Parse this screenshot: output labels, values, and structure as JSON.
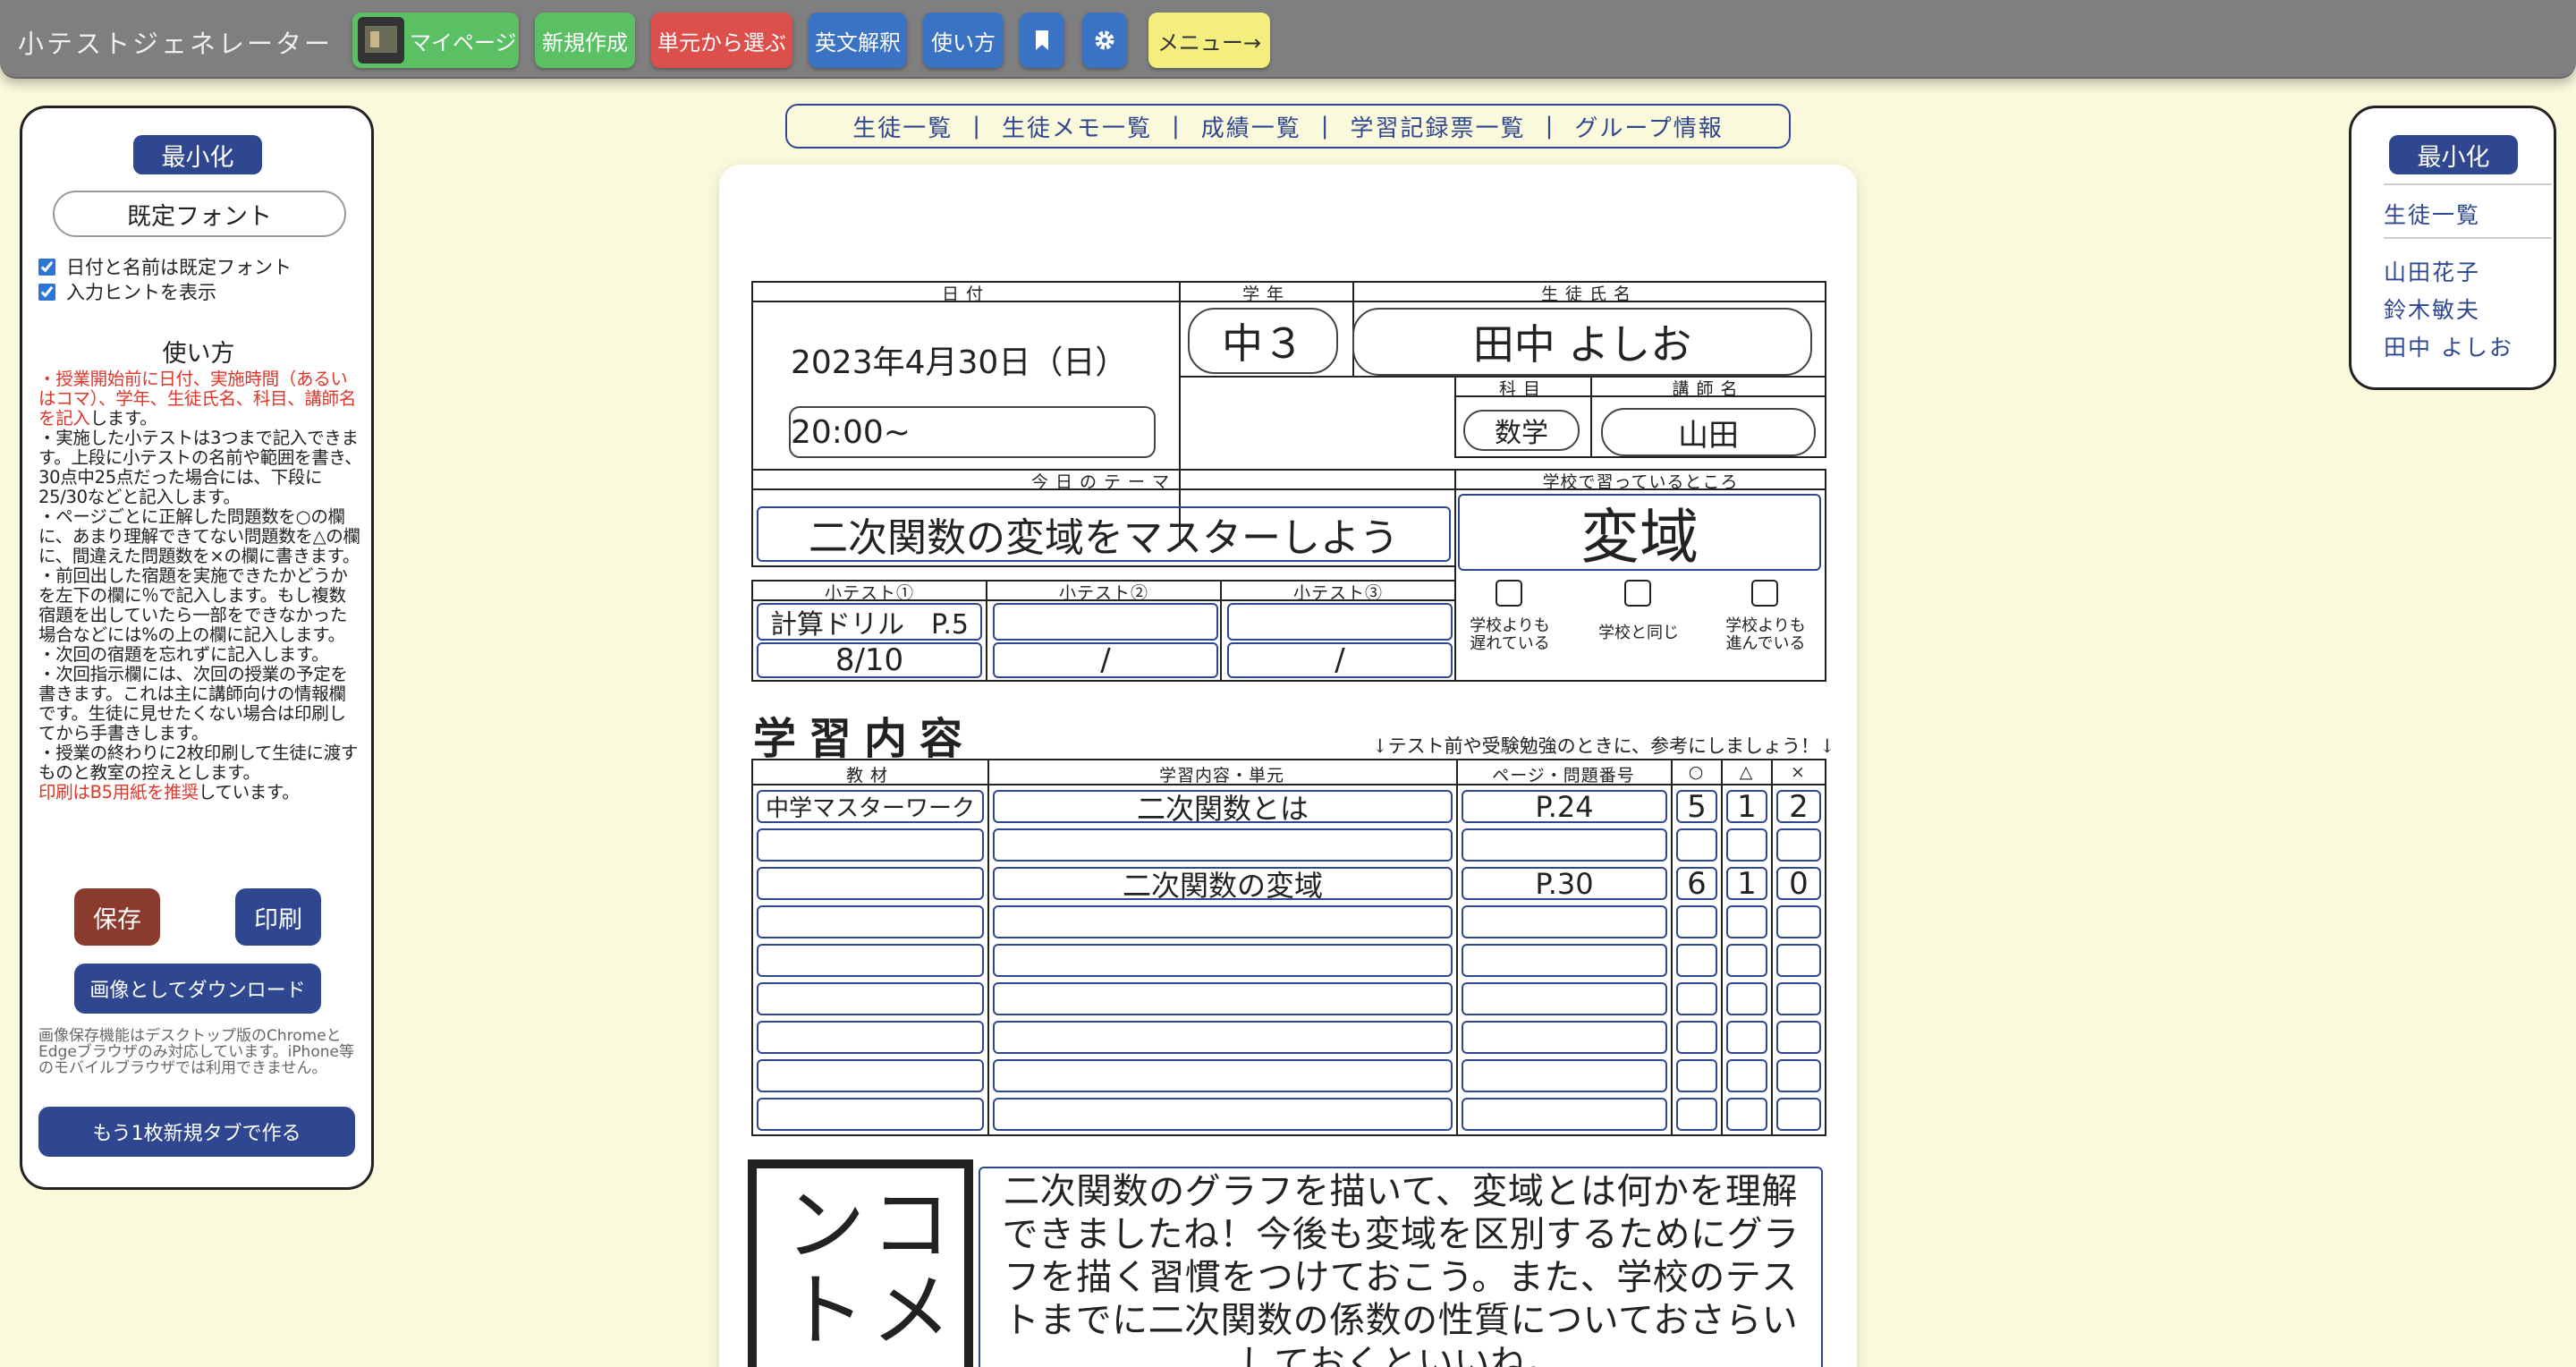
{
  "app_title": "小テストジェネレーター",
  "nav": {
    "mypage": "マイページ",
    "new": "新規作成",
    "unit": "単元から選ぶ",
    "english": "英文解釈",
    "howto": "使い方",
    "menu": "メニュー→",
    "colors": {
      "green": "#5bc063",
      "red": "#dc4f4a",
      "blue": "#3a72c4",
      "yellow": "#f4ee7e"
    }
  },
  "left": {
    "minimize": "最小化",
    "font_button": "既定フォント",
    "check1": "日付と名前は既定フォント",
    "check2": "入力ヒントを表示",
    "howto_title": "使い方",
    "p1_red": "・授業開始前に日付、実施時間（あるいはコマ）、学年、生徒氏名、科目、講師名を記入",
    "p1_rest": "します。",
    "p2": "・実施した小テストは3つまで記入できます。上段に小テストの名前や範囲を書き、30点中25点だった場合には、下段に25/30などと記入します。",
    "p3": "・ページごとに正解した問題数を○の欄に、あまり理解できてない問題数を△の欄に、間違えた問題数を×の欄に書きます。",
    "p4": "・前回出した宿題を実施できたかどうかを左下の欄に％で記入します。もし複数宿題を出していたら一部をできなかった場合などには%の上の欄に記入します。",
    "p5": "・次回の宿題を忘れずに記入します。",
    "p6": "・次回指示欄には、次回の授業の予定を書きます。これは主に講師向けの情報欄です。生徒に見せたくない場合は印刷してから手書きします。",
    "p7": "・授業の終わりに2枚印刷して生徒に渡すものと教室の控えとします。",
    "p8_red": "印刷はB5用紙を推奨",
    "p8_rest": "しています。",
    "save": "保存",
    "print": "印刷",
    "download": "画像としてダウンロード",
    "dl_note": "画像保存機能はデスクトップ版のChromeとEdgeブラウザのみ対応しています。iPhone等のモバイルブラウザでは利用できません。",
    "new_tab": "もう1枚新規タブで作る"
  },
  "subnav": [
    "生徒一覧",
    "生徒メモ一覧",
    "成績一覧",
    "学習記録票一覧",
    "グループ情報"
  ],
  "subnav_sep": "|",
  "right": {
    "minimize": "最小化",
    "list": "生徒一覧",
    "students": [
      "山田花子",
      "鈴木敏夫",
      "田中 よしお"
    ]
  },
  "sheet": {
    "h_date": "日付",
    "h_grade": "学年",
    "h_name": "生徒氏名",
    "date": "2023年4月30日（日）",
    "time": "20:00~",
    "grade": "中３",
    "name": "田中 よしお",
    "h_subject": "科目",
    "h_teacher": "講師名",
    "subject": "数学",
    "teacher": "山田",
    "h_theme": "今日のテーマ",
    "h_school": "学校で習っているところ",
    "theme": "二次関数の変域をマスターしよう",
    "school": "変域",
    "quiz_heads": [
      "小テスト①",
      "小テスト②",
      "小テスト③"
    ],
    "quiz_names": [
      "計算ドリル　P.5",
      "",
      ""
    ],
    "quiz_scores": [
      "8/10",
      "/",
      "/"
    ],
    "pace_a1": "学校よりも",
    "pace_a2": "遅れている",
    "pace_b": "学校と同じ",
    "pace_c1": "学校よりも",
    "pace_c2": "進んでいる",
    "study_title": "学習内容",
    "study_hint": "↓テスト前や受験勉強のときに、参考にしましょう！↓",
    "col_material": "教材",
    "col_content": "学習内容・単元",
    "col_page": "ページ・問題番号",
    "col_o": "○",
    "col_t": "△",
    "col_x": "×",
    "rows": [
      {
        "material": "中学マスターワーク",
        "content": "二次関数とは",
        "page": "P.24",
        "o": "5",
        "t": "1",
        "x": "2"
      },
      {
        "material": "",
        "content": "",
        "page": "",
        "o": "",
        "t": "",
        "x": ""
      },
      {
        "material": "",
        "content": "二次関数の変域",
        "page": "P.30",
        "o": "6",
        "t": "1",
        "x": "0"
      },
      {
        "material": "",
        "content": "",
        "page": "",
        "o": "",
        "t": "",
        "x": ""
      },
      {
        "material": "",
        "content": "",
        "page": "",
        "o": "",
        "t": "",
        "x": ""
      },
      {
        "material": "",
        "content": "",
        "page": "",
        "o": "",
        "t": "",
        "x": ""
      },
      {
        "material": "",
        "content": "",
        "page": "",
        "o": "",
        "t": "",
        "x": ""
      },
      {
        "material": "",
        "content": "",
        "page": "",
        "o": "",
        "t": "",
        "x": ""
      },
      {
        "material": "",
        "content": "",
        "page": "",
        "o": "",
        "t": "",
        "x": ""
      }
    ],
    "comment_label": "コメント",
    "comment": "二次関数のグラフを描いて、変域とは何かを理解できましたね！今後も変域を区別するためにグラフを描く習慣をつけておこう。また、学校のテストまでに二次関数の係数の性質についておさらいしておくといいね。"
  }
}
